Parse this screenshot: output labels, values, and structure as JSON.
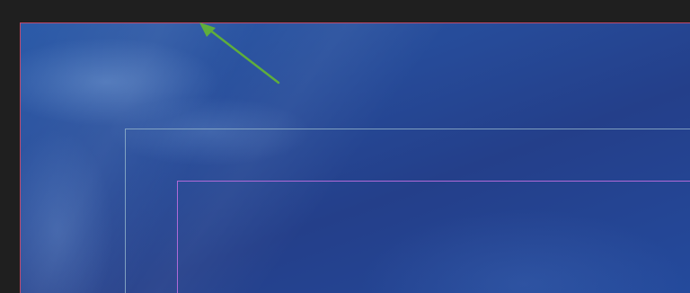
{
  "canvas": {
    "border_color": "#c24a6a",
    "background_primary": "#264b99",
    "background_highlight": "#2b5aa8"
  },
  "guides": [
    {
      "name": "outer-safe-area",
      "color": "#8fb0c9"
    },
    {
      "name": "inner-safe-area",
      "color": "#b06ad8"
    }
  ],
  "annotation": {
    "type": "arrow",
    "color": "#5fae3c",
    "icon": "arrow-icon"
  }
}
